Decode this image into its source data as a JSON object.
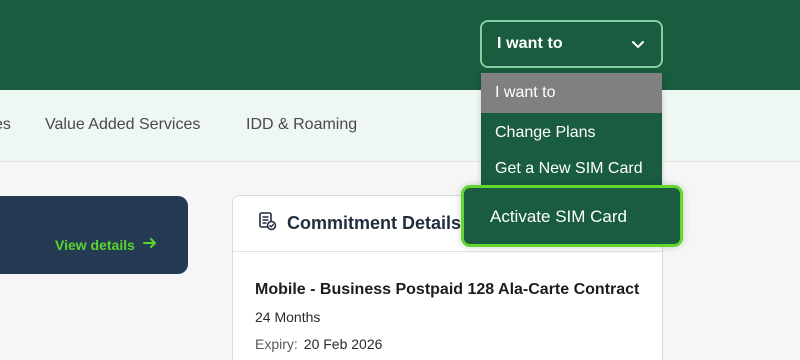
{
  "header": {
    "select": {
      "label": "I want to",
      "icon": "chevron-down-icon"
    }
  },
  "nav": {
    "items": [
      {
        "label": "es"
      },
      {
        "label": "Value Added Services"
      },
      {
        "label": "IDD & Roaming"
      }
    ]
  },
  "dropdown": {
    "options": [
      {
        "label": "I want to",
        "selected": true
      },
      {
        "label": "Change Plans"
      },
      {
        "label": "Get a New SIM Card"
      },
      {
        "label": "Activate SIM Card",
        "highlighted": true
      }
    ]
  },
  "left_card": {
    "link_label": "View details",
    "link_icon": "arrow-right-icon"
  },
  "commitment": {
    "title": "Commitment Details",
    "icon": "contract-check-icon",
    "plan_name": "Mobile - Business Postpaid 128 Ala-Carte Contract",
    "duration": "24 Months",
    "expiry_label": "Expiry:",
    "expiry_date": "20 Feb 2026"
  },
  "colors": {
    "brand_green": "#1a5c40",
    "accent_green": "#61d62f",
    "nav_bg": "#eef7f2",
    "card_navy": "#253b53",
    "selected_gray": "#808080"
  }
}
